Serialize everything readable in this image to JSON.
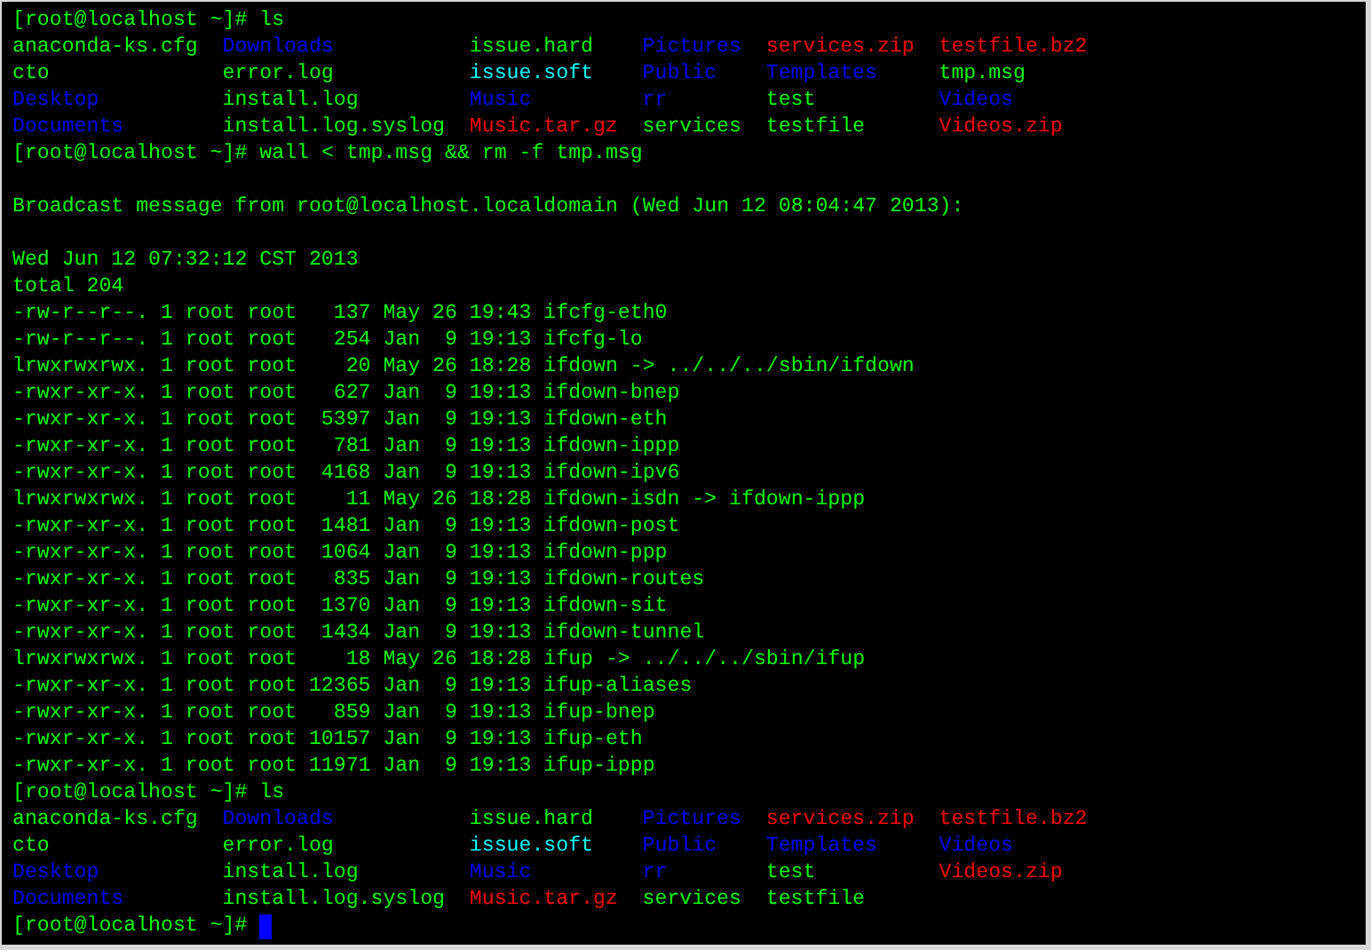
{
  "terminal": {
    "lines": [
      {
        "kind": "prompt",
        "prompt": "[root@localhost ~]#",
        "command": "ls"
      },
      {
        "kind": "listing",
        "rows": [
          [
            {
              "text": "anaconda-ks.cfg",
              "color": "#00ff00"
            },
            {
              "text": "Downloads",
              "color": "#0000ff"
            },
            {
              "text": "issue.hard",
              "color": "#00ff00"
            },
            {
              "text": "Pictures",
              "color": "#0000ff"
            },
            {
              "text": "services.zip",
              "color": "#ff0000"
            },
            {
              "text": "testfile.bz2",
              "color": "#ff0000"
            }
          ],
          [
            {
              "text": "cto",
              "color": "#00ff00"
            },
            {
              "text": "error.log",
              "color": "#00ff00"
            },
            {
              "text": "issue.soft",
              "color": "#00ffff"
            },
            {
              "text": "Public",
              "color": "#0000ff"
            },
            {
              "text": "Templates",
              "color": "#0000ff"
            },
            {
              "text": "tmp.msg",
              "color": "#00ff00"
            }
          ],
          [
            {
              "text": "Desktop",
              "color": "#0000ff"
            },
            {
              "text": "install.log",
              "color": "#00ff00"
            },
            {
              "text": "Music",
              "color": "#0000ff"
            },
            {
              "text": "rr",
              "color": "#0000ff"
            },
            {
              "text": "test",
              "color": "#00ff00"
            },
            {
              "text": "Videos",
              "color": "#0000ff"
            }
          ],
          [
            {
              "text": "Documents",
              "color": "#0000ff"
            },
            {
              "text": "install.log.syslog",
              "color": "#00ff00"
            },
            {
              "text": "Music.tar.gz",
              "color": "#ff0000"
            },
            {
              "text": "services",
              "color": "#00ff00"
            },
            {
              "text": "testfile",
              "color": "#00ff00"
            },
            {
              "text": "Videos.zip",
              "color": "#ff0000"
            }
          ]
        ]
      },
      {
        "kind": "prompt",
        "prompt": "[root@localhost ~]#",
        "command": "wall < tmp.msg && rm -f tmp.msg"
      },
      {
        "kind": "blank"
      },
      {
        "kind": "text",
        "text": "Broadcast message from root@localhost.localdomain (Wed Jun 12 08:04:47 2013):"
      },
      {
        "kind": "blank"
      },
      {
        "kind": "text",
        "text": "Wed Jun 12 07:32:12 CST 2013"
      },
      {
        "kind": "text",
        "text": "total 204"
      },
      {
        "kind": "text",
        "text": "-rw-r--r--. 1 root root   137 May 26 19:43 ifcfg-eth0"
      },
      {
        "kind": "text",
        "text": "-rw-r--r--. 1 root root   254 Jan  9 19:13 ifcfg-lo"
      },
      {
        "kind": "text",
        "text": "lrwxrwxrwx. 1 root root    20 May 26 18:28 ifdown -> ../../../sbin/ifdown"
      },
      {
        "kind": "text",
        "text": "-rwxr-xr-x. 1 root root   627 Jan  9 19:13 ifdown-bnep"
      },
      {
        "kind": "text",
        "text": "-rwxr-xr-x. 1 root root  5397 Jan  9 19:13 ifdown-eth"
      },
      {
        "kind": "text",
        "text": "-rwxr-xr-x. 1 root root   781 Jan  9 19:13 ifdown-ippp"
      },
      {
        "kind": "text",
        "text": "-rwxr-xr-x. 1 root root  4168 Jan  9 19:13 ifdown-ipv6"
      },
      {
        "kind": "text",
        "text": "lrwxrwxrwx. 1 root root    11 May 26 18:28 ifdown-isdn -> ifdown-ippp"
      },
      {
        "kind": "text",
        "text": "-rwxr-xr-x. 1 root root  1481 Jan  9 19:13 ifdown-post"
      },
      {
        "kind": "text",
        "text": "-rwxr-xr-x. 1 root root  1064 Jan  9 19:13 ifdown-ppp"
      },
      {
        "kind": "text",
        "text": "-rwxr-xr-x. 1 root root   835 Jan  9 19:13 ifdown-routes"
      },
      {
        "kind": "text",
        "text": "-rwxr-xr-x. 1 root root  1370 Jan  9 19:13 ifdown-sit"
      },
      {
        "kind": "text",
        "text": "-rwxr-xr-x. 1 root root  1434 Jan  9 19:13 ifdown-tunnel"
      },
      {
        "kind": "text",
        "text": "lrwxrwxrwx. 1 root root    18 May 26 18:28 ifup -> ../../../sbin/ifup"
      },
      {
        "kind": "text",
        "text": "-rwxr-xr-x. 1 root root 12365 Jan  9 19:13 ifup-aliases"
      },
      {
        "kind": "text",
        "text": "-rwxr-xr-x. 1 root root   859 Jan  9 19:13 ifup-bnep"
      },
      {
        "kind": "text",
        "text": "-rwxr-xr-x. 1 root root 10157 Jan  9 19:13 ifup-eth"
      },
      {
        "kind": "text",
        "text": "-rwxr-xr-x. 1 root root 11971 Jan  9 19:13 ifup-ippp"
      },
      {
        "kind": "prompt",
        "prompt": "[root@localhost ~]#",
        "command": "ls"
      },
      {
        "kind": "listing",
        "rows": [
          [
            {
              "text": "anaconda-ks.cfg",
              "color": "#00ff00"
            },
            {
              "text": "Downloads",
              "color": "#0000ff"
            },
            {
              "text": "issue.hard",
              "color": "#00ff00"
            },
            {
              "text": "Pictures",
              "color": "#0000ff"
            },
            {
              "text": "services.zip",
              "color": "#ff0000"
            },
            {
              "text": "testfile.bz2",
              "color": "#ff0000"
            }
          ],
          [
            {
              "text": "cto",
              "color": "#00ff00"
            },
            {
              "text": "error.log",
              "color": "#00ff00"
            },
            {
              "text": "issue.soft",
              "color": "#00ffff"
            },
            {
              "text": "Public",
              "color": "#0000ff"
            },
            {
              "text": "Templates",
              "color": "#0000ff"
            },
            {
              "text": "Videos",
              "color": "#0000ff"
            }
          ],
          [
            {
              "text": "Desktop",
              "color": "#0000ff"
            },
            {
              "text": "install.log",
              "color": "#00ff00"
            },
            {
              "text": "Music",
              "color": "#0000ff"
            },
            {
              "text": "rr",
              "color": "#0000ff"
            },
            {
              "text": "test",
              "color": "#00ff00"
            },
            {
              "text": "Videos.zip",
              "color": "#ff0000"
            }
          ],
          [
            {
              "text": "Documents",
              "color": "#0000ff"
            },
            {
              "text": "install.log.syslog",
              "color": "#00ff00"
            },
            {
              "text": "Music.tar.gz",
              "color": "#ff0000"
            },
            {
              "text": "services",
              "color": "#00ff00"
            },
            {
              "text": "testfile",
              "color": "#00ff00"
            }
          ]
        ]
      },
      {
        "kind": "prompt",
        "prompt": "[root@localhost ~]#",
        "cursor": true
      }
    ]
  }
}
